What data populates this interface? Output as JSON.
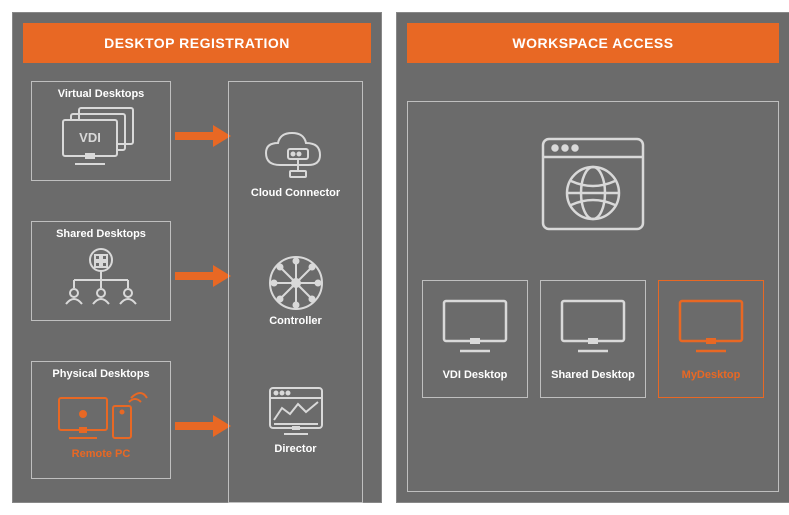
{
  "left": {
    "title": "DESKTOP REGISTRATION",
    "sources": {
      "virtual": {
        "label": "Virtual Desktops",
        "badge": "VDI"
      },
      "shared": {
        "label": "Shared Desktops"
      },
      "physical": {
        "label": "Physical Desktops",
        "sublabel": "Remote PC"
      }
    },
    "services": {
      "cloud": {
        "label": "Cloud Connector"
      },
      "controller": {
        "label": "Controller"
      },
      "director": {
        "label": "Director"
      }
    }
  },
  "right": {
    "title": "WORKSPACE ACCESS",
    "tiles": {
      "vdi": {
        "label": "VDI Desktop"
      },
      "shared": {
        "label": "Shared Desktop"
      },
      "my": {
        "label": "MyDesktop"
      }
    }
  }
}
